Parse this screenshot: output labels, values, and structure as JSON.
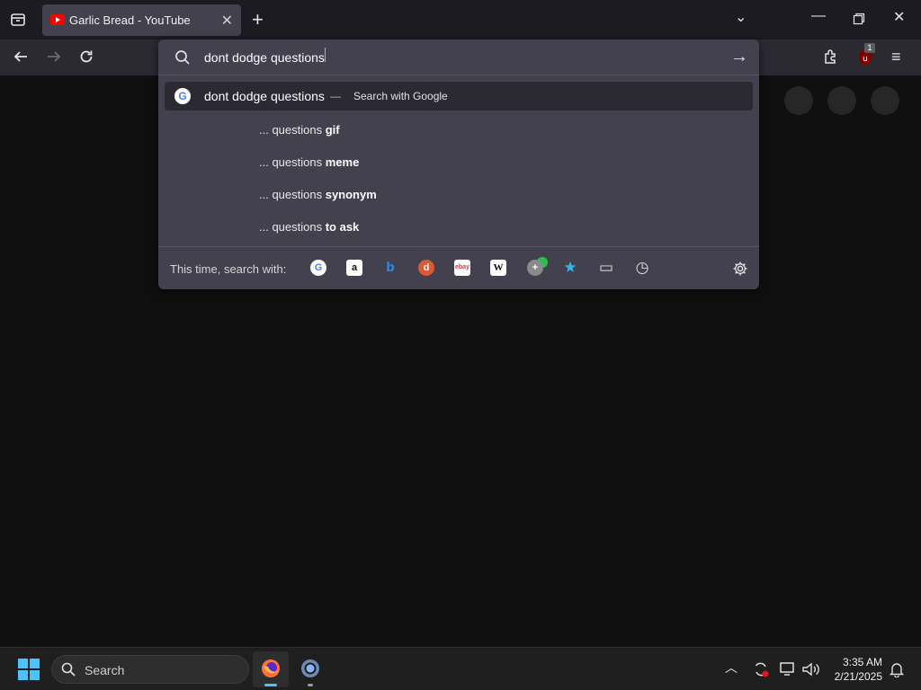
{
  "tab": {
    "title": "Garlic Bread - YouTube"
  },
  "urlbar": {
    "value": "dont dodge questions"
  },
  "suggestions": {
    "primary_query": "dont dodge questions",
    "primary_separator": "—",
    "primary_action": "Search with Google",
    "items": [
      {
        "prefix": "... questions ",
        "suffix": "gif"
      },
      {
        "prefix": "... questions ",
        "suffix": "meme"
      },
      {
        "prefix": "... questions ",
        "suffix": "synonym"
      },
      {
        "prefix": "... questions ",
        "suffix": "to ask"
      }
    ]
  },
  "search_with": {
    "label": "This time, search with:",
    "engines": [
      {
        "icon": "google-icon",
        "glyph": "G"
      },
      {
        "icon": "amazon-icon",
        "glyph": "a"
      },
      {
        "icon": "bing-icon",
        "glyph": "b"
      },
      {
        "icon": "duckduckgo-icon",
        "glyph": "d"
      },
      {
        "icon": "ebay-icon",
        "glyph": "ebay"
      },
      {
        "icon": "wikipedia-icon",
        "glyph": "W"
      },
      {
        "icon": "add-engine-icon",
        "glyph": "+"
      },
      {
        "icon": "bookmarks-star-icon",
        "glyph": "★"
      },
      {
        "icon": "tabs-icon",
        "glyph": "▭"
      },
      {
        "icon": "history-clock-icon",
        "glyph": "◷"
      }
    ]
  },
  "extensions": {
    "ublock_badge": "1"
  },
  "taskbar": {
    "search_placeholder": "Search",
    "time": "3:35 AM",
    "date": "2/21/2025"
  },
  "colors": {
    "accent_blue": "#4cc2ff",
    "youtube_red": "#ff0000",
    "panel_bg": "#42414d"
  }
}
